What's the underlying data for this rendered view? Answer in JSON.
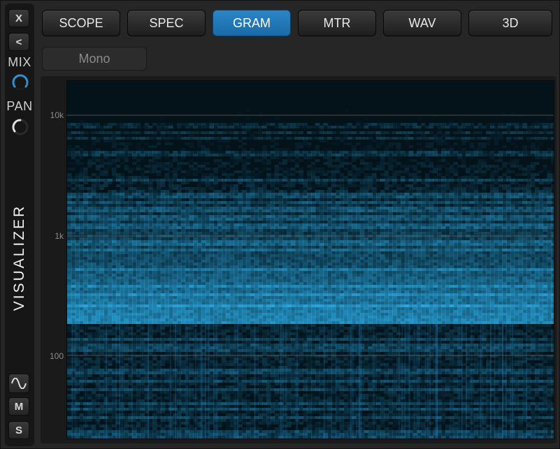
{
  "sidebar": {
    "close_label": "X",
    "back_label": "<",
    "mix_label": "MIX",
    "pan_label": "PAN",
    "title": "VISUALIZER",
    "m_label": "M",
    "s_label": "S",
    "wave_icon": "sine-wave-icon"
  },
  "tabs": [
    {
      "label": "SCOPE",
      "active": false
    },
    {
      "label": "SPEC",
      "active": false
    },
    {
      "label": "GRAM",
      "active": true
    },
    {
      "label": "MTR",
      "active": false
    },
    {
      "label": "WAV",
      "active": false
    },
    {
      "label": "3D",
      "active": false
    }
  ],
  "mono_label": "Mono",
  "graph": {
    "y_labels": [
      "10k",
      "1k",
      "100"
    ]
  },
  "colors": {
    "accent": "#1f7ab8",
    "spectrogram": "#2aa8e0"
  }
}
